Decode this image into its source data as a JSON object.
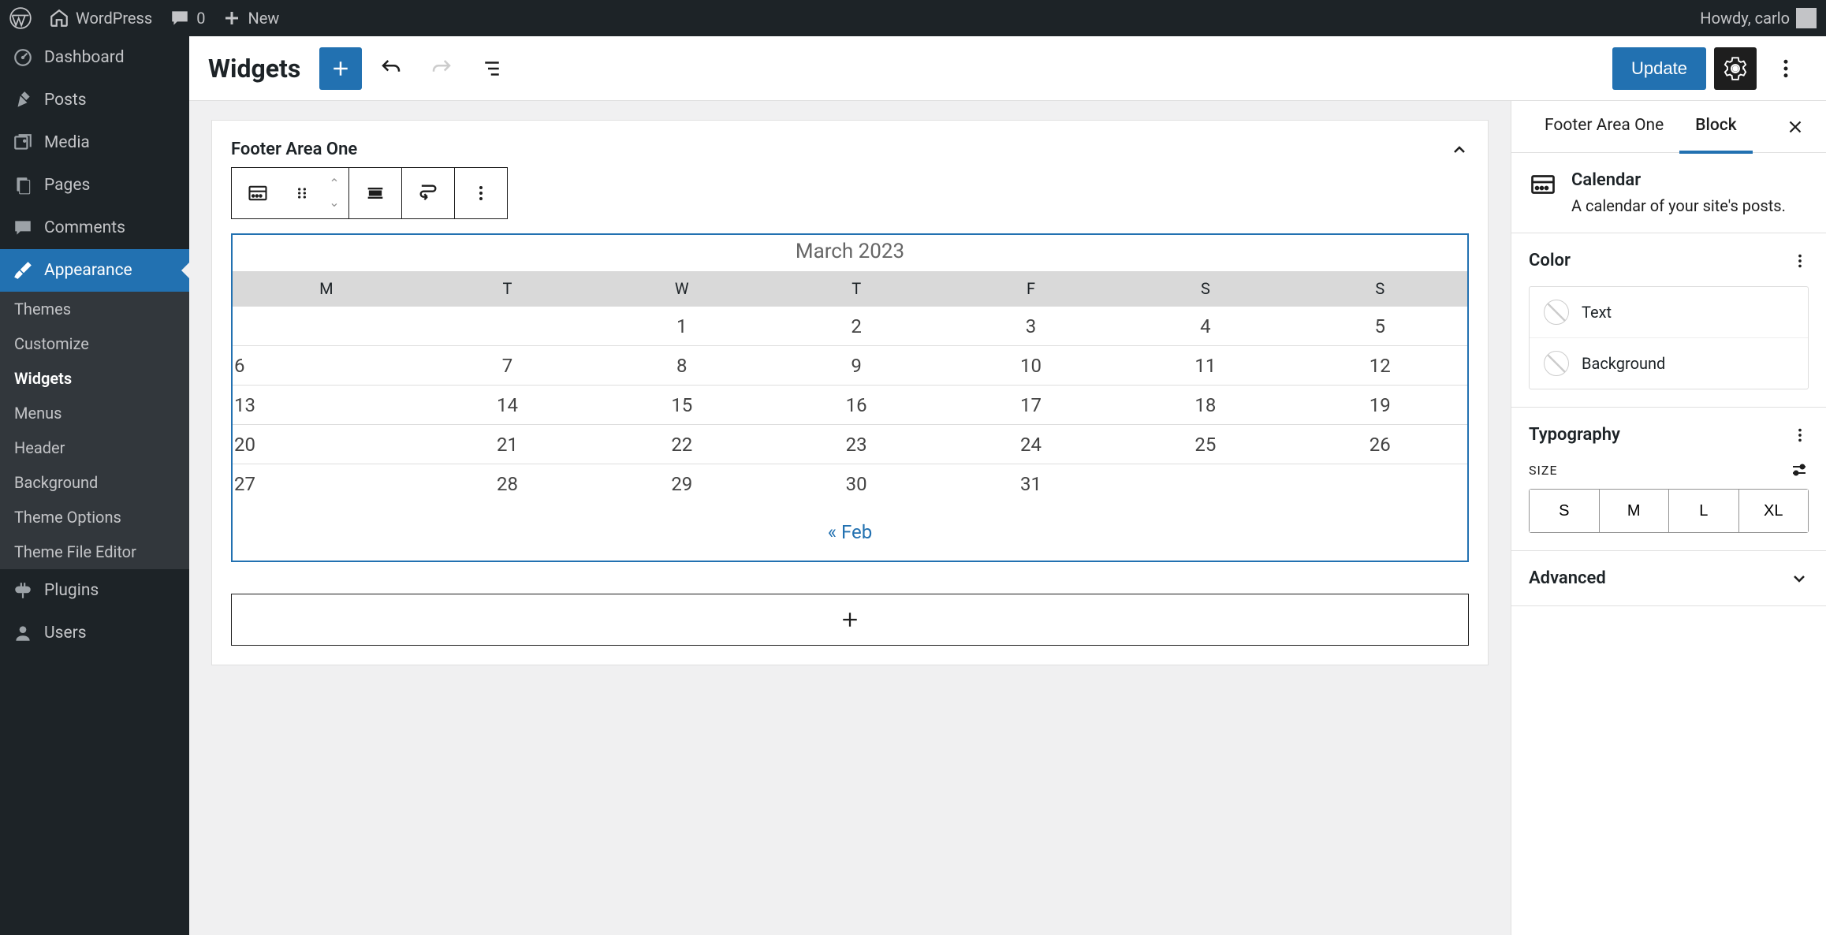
{
  "adminBar": {
    "siteName": "WordPress",
    "comments": "0",
    "new": "New",
    "howdy": "Howdy, carlo"
  },
  "sidebar": {
    "items": [
      {
        "label": "Dashboard",
        "icon": "dashboard"
      },
      {
        "label": "Posts",
        "icon": "pin"
      },
      {
        "label": "Media",
        "icon": "media"
      },
      {
        "label": "Pages",
        "icon": "page"
      },
      {
        "label": "Comments",
        "icon": "comment"
      },
      {
        "label": "Appearance",
        "icon": "brush",
        "active": true
      },
      {
        "label": "Plugins",
        "icon": "plug"
      },
      {
        "label": "Users",
        "icon": "user"
      }
    ],
    "submenu": [
      "Themes",
      "Customize",
      "Widgets",
      "Menus",
      "Header",
      "Background",
      "Theme Options",
      "Theme File Editor"
    ],
    "activeSub": "Widgets"
  },
  "editor": {
    "title": "Widgets",
    "updateLabel": "Update"
  },
  "widgetArea": {
    "title": "Footer Area One"
  },
  "calendar": {
    "caption": "March 2023",
    "dayHeaders": [
      "M",
      "T",
      "W",
      "T",
      "F",
      "S",
      "S"
    ],
    "weeks": [
      [
        "",
        "",
        "1",
        "2",
        "3",
        "4",
        "5"
      ],
      [
        "6",
        "7",
        "8",
        "9",
        "10",
        "11",
        "12"
      ],
      [
        "13",
        "14",
        "15",
        "16",
        "17",
        "18",
        "19"
      ],
      [
        "20",
        "21",
        "22",
        "23",
        "24",
        "25",
        "26"
      ],
      [
        "27",
        "28",
        "29",
        "30",
        "31",
        "",
        ""
      ]
    ],
    "prevLink": "« Feb"
  },
  "inspector": {
    "tabs": [
      "Footer Area One",
      "Block"
    ],
    "activeTab": "Block",
    "blockName": "Calendar",
    "blockDesc": "A calendar of your site's posts.",
    "panels": {
      "color": "Color",
      "colorOptions": [
        "Text",
        "Background"
      ],
      "typography": "Typography",
      "sizeLabel": "SIZE",
      "sizes": [
        "S",
        "M",
        "L",
        "XL"
      ],
      "advanced": "Advanced"
    }
  }
}
